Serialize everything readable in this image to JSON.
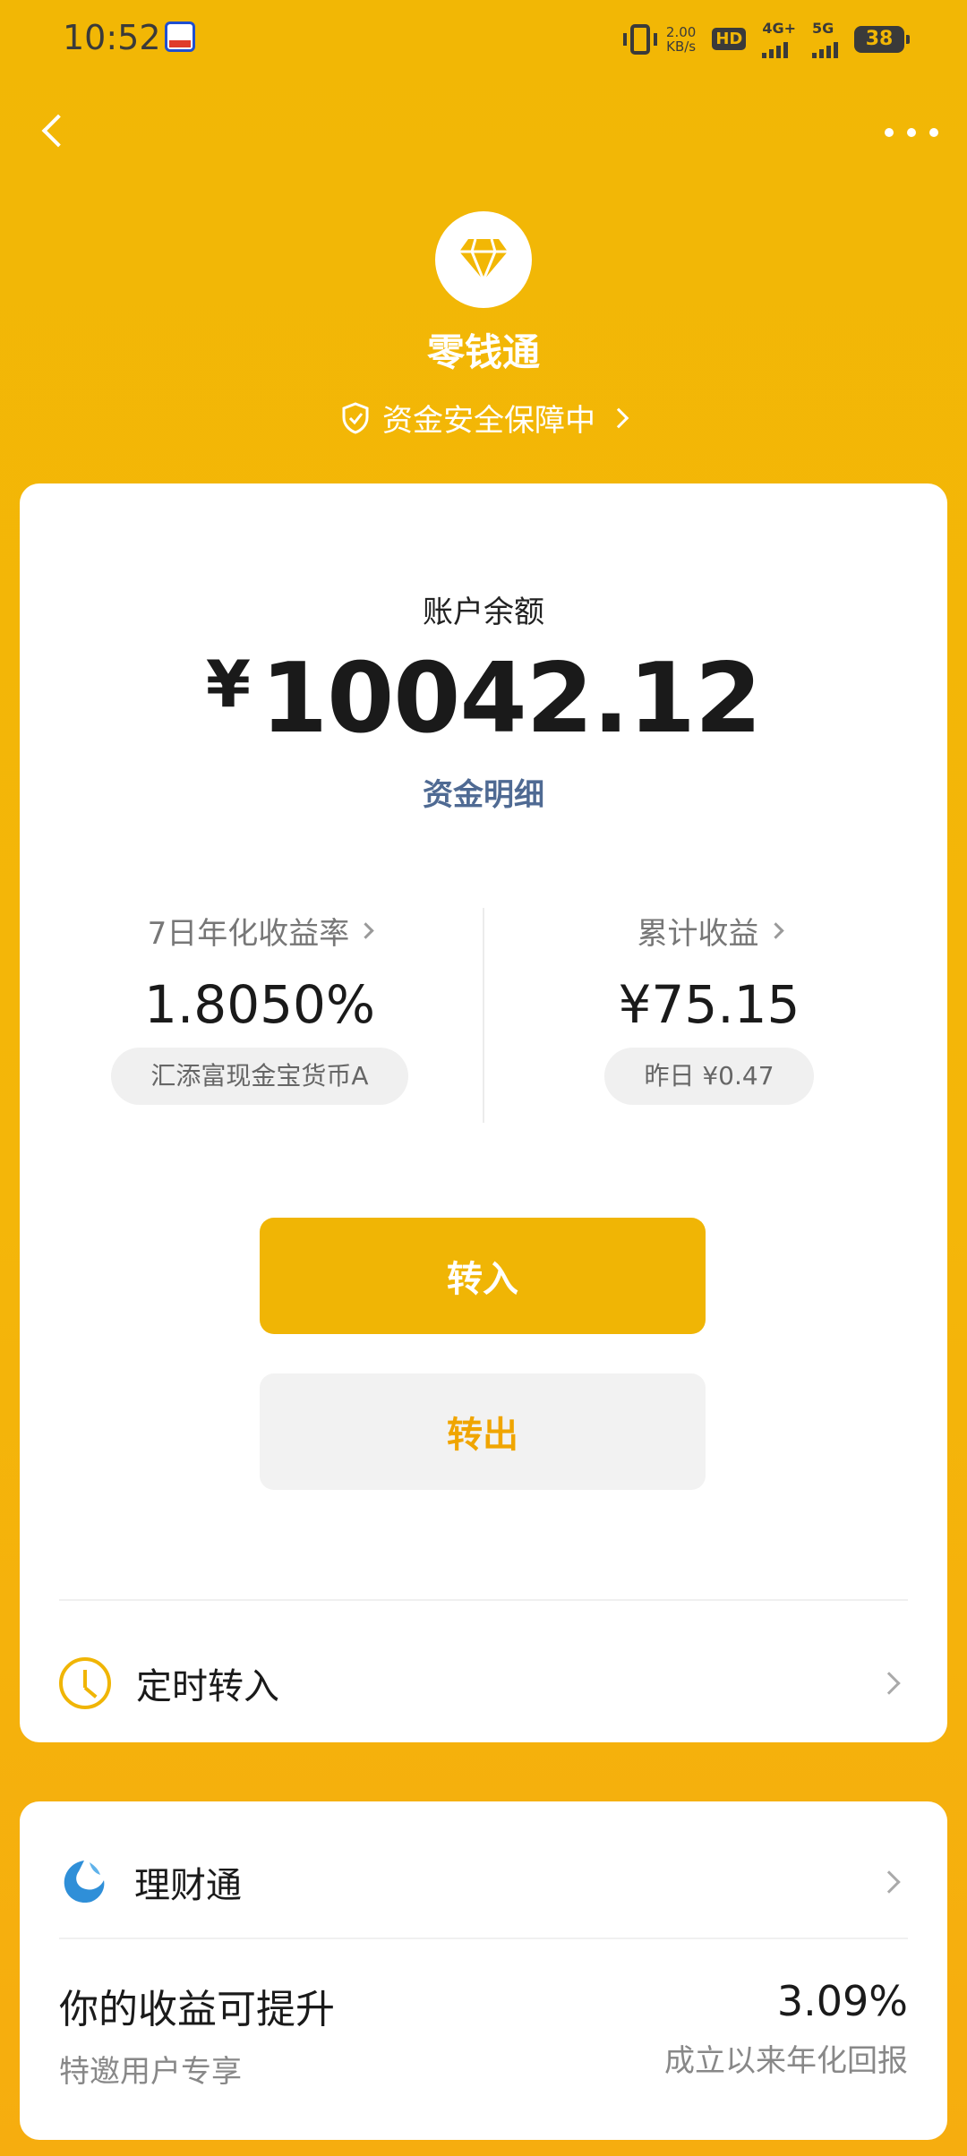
{
  "status_bar": {
    "time": "10:52",
    "net_speed_value": "2.00",
    "net_speed_unit": "KB/s",
    "hd_label": "HD",
    "sim1_label": "4G+",
    "sim2_label": "5G",
    "battery": "38"
  },
  "header": {
    "brand_title": "零钱通",
    "security_text": "资金安全保障中"
  },
  "balance": {
    "label": "账户余额",
    "currency": "¥",
    "amount": "10042.12",
    "detail_link": "资金明细"
  },
  "stats": {
    "yield_label": "7日年化收益率",
    "yield_value": "1.8050%",
    "fund_name": "汇添富现金宝货币A",
    "earnings_label": "累计收益",
    "earnings_value": "¥75.15",
    "yesterday": "昨日 ¥0.47"
  },
  "actions": {
    "transfer_in": "转入",
    "transfer_out": "转出"
  },
  "scheduled": {
    "label": "定时转入"
  },
  "licaitong": {
    "label": "理财通",
    "promo_title": "你的收益可提升",
    "promo_sub": "特邀用户专享",
    "promo_rate": "3.09%",
    "promo_rate_sub": "成立以来年化回报"
  },
  "colors": {
    "brand_yellow": "#f2b705",
    "button_yellow": "#f0b505",
    "link_blue": "#4f6a93"
  }
}
